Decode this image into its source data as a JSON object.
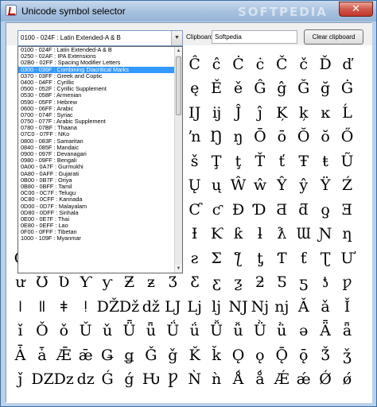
{
  "window": {
    "title": "Unicode symbol selector",
    "watermark": "SOFTPEDIA",
    "close_glyph": "✕"
  },
  "toolbar": {
    "block_selected": "0100 - 024F :  Latin Extended-A & B",
    "select_arrow": "▼",
    "clipboard_label": "Clipboard:",
    "clipboard_value": "Softpedia",
    "clear_button": "Clear clipboard"
  },
  "dropdown": {
    "items": [
      "0100 - 024F :  Latin Extended-A & B",
      "0250 - 02AF :  IPA Extensions",
      "02B0 - 02FF :  Spacing Modifier Letters",
      "0300 - 036F :  Combining Diacritical Marks",
      "0370 - 03FF :  Greek and Coptic",
      "0400 - 04FF :  Cyrillic",
      "0500 - 052F :  Cyrillic Supplement",
      "0530 - 058F :  Armenian",
      "0590 - 05FF :  Hebrew",
      "0600 - 06FF :  Arabic",
      "0700 - 074F :  Syriac",
      "0750 - 077F :  Arabic Supplement",
      "0780 - 07BF :  Thaana",
      "07C0 - 07FF :  NKo",
      "0800 - 083F :  Samaritan",
      "0840 - 085F :  Mandaic",
      "0900 - 097F :  Devanagari",
      "0980 - 09FF :  Bengali",
      "0A00 - 0A7F :  Gurmukhi",
      "0A80 - 0AFF :  Gujarati",
      "0B00 - 0B7F :  Oriya",
      "0B80 - 0BFF :  Tamil",
      "0C00 - 0C7F :  Telugu",
      "0C80 - 0CFF :  Kannada",
      "0D00 - 0D7F :  Malayalam",
      "0D80 - 0DFF :  Sinhala",
      "0E00 - 0E7F :  Thai",
      "0E80 - 0EFF :  Lao",
      "0F00 - 0FFF :  Tibetan",
      "1000 - 109F :  Myanmar"
    ],
    "selected_index": 3,
    "scroll_up": "▲",
    "scroll_down": "▼"
  },
  "grid": {
    "rows": [
      [
        "",
        "",
        "",
        "",
        "",
        "",
        "",
        "",
        "",
        "",
        "",
        "",
        "",
        "",
        "",
        "",
        ""
      ],
      [
        "",
        "",
        "",
        "",
        "",
        "",
        "",
        "",
        "",
        "",
        "",
        "",
        "Ĉ",
        "ĉ",
        "Ċ",
        "ċ",
        "Č",
        "č",
        "Ď",
        "ď"
      ],
      [
        "",
        "",
        "",
        "",
        "",
        "",
        "",
        "",
        "",
        "",
        "",
        "",
        "ę",
        "Ě",
        "ě",
        "Ĝ",
        "ĝ",
        "Ğ",
        "ğ",
        "Ġ"
      ],
      [
        "",
        "",
        "",
        "",
        "",
        "",
        "",
        "",
        "",
        "",
        "",
        "",
        "Ĳ",
        "ĳ",
        "Ĵ",
        "ĵ",
        "Ķ",
        "ķ",
        "ĸ",
        "Ĺ"
      ],
      [
        "",
        "",
        "",
        "",
        "",
        "",
        "",
        "",
        "",
        "",
        "",
        "",
        "ŉ",
        "Ŋ",
        "ŋ",
        "Ō",
        "ō",
        "Ŏ",
        "ŏ",
        "Ő"
      ],
      [
        "",
        "",
        "",
        "",
        "",
        "",
        "",
        "",
        "",
        "",
        "",
        "",
        "š",
        "Ţ",
        "ţ",
        "Ť",
        "ť",
        "Ŧ",
        "ŧ",
        "Ũ"
      ],
      [
        "",
        "",
        "",
        "",
        "",
        "",
        "",
        "",
        "",
        "",
        "",
        "",
        "Ų",
        "ų",
        "Ŵ",
        "ŵ",
        "Ŷ",
        "ŷ",
        "Ÿ",
        "Ź"
      ],
      [
        "",
        "",
        "",
        "",
        "",
        "",
        "",
        "",
        "",
        "",
        "",
        "",
        "Ƈ",
        "ƈ",
        "Ɖ",
        "Ɗ",
        "Ƌ",
        "ƌ",
        "ƍ",
        "Ǝ"
      ],
      [
        "",
        "",
        "",
        "",
        "",
        "",
        "",
        "",
        "",
        "",
        "",
        "",
        "Ɨ",
        "Ƙ",
        "ƙ",
        "ƚ",
        "ƛ",
        "Ɯ",
        "Ɲ",
        "ƞ"
      ],
      [
        "Ơ",
        "ơ",
        "Ƣ",
        "ƣ",
        "Ƥ",
        "ƥ",
        "Ʀ",
        "Ƨ",
        "ƨ",
        "Ʃ",
        "ƪ",
        "ƫ",
        "Ƭ",
        "ƭ",
        "Ʈ",
        "Ư"
      ],
      [
        "ư",
        "Ʊ",
        "Ʋ",
        "Ƴ",
        "ƴ",
        "Ƶ",
        "ƶ",
        "Ʒ",
        "Ƹ",
        "ƹ",
        "ƺ",
        "ƻ",
        "Ƽ",
        "ƽ",
        "ƾ",
        "ƿ"
      ],
      [
        "ǀ",
        "ǁ",
        "ǂ",
        "ǃ",
        "Ǆ",
        "ǅ",
        "ǆ",
        "Ǉ",
        "ǈ",
        "ǉ",
        "Ǌ",
        "ǋ",
        "ǌ",
        "Ǎ",
        "ǎ",
        "Ǐ"
      ],
      [
        "ǐ",
        "Ǒ",
        "ǒ",
        "Ǔ",
        "ǔ",
        "Ǖ",
        "ǖ",
        "Ǘ",
        "ǘ",
        "Ǚ",
        "ǚ",
        "Ǜ",
        "ǜ",
        "ǝ",
        "Ǟ",
        "ǟ"
      ],
      [
        "Ǡ",
        "ǡ",
        "Ǣ",
        "ǣ",
        "Ǥ",
        "ǥ",
        "Ǧ",
        "ǧ",
        "Ǩ",
        "ǩ",
        "Ǫ",
        "ǫ",
        "Ǭ",
        "ǭ",
        "Ǯ",
        "ǯ"
      ],
      [
        "ǰ",
        "Ǳ",
        "ǲ",
        "ǳ",
        "Ǵ",
        "ǵ",
        "Ƕ",
        "Ƿ",
        "Ǹ",
        "ǹ",
        "Ǻ",
        "ǻ",
        "Ǽ",
        "ǽ",
        "Ǿ",
        "ǿ"
      ]
    ]
  }
}
